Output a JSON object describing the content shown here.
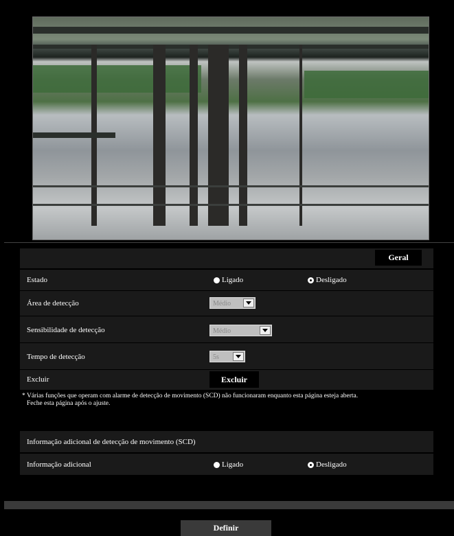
{
  "header_tab": "Geral",
  "rows": {
    "estado": {
      "label": "Estado",
      "on": "Ligado",
      "off": "Desligado",
      "selected": "off"
    },
    "area": {
      "label": "Área de detecção",
      "value": "Médio"
    },
    "sens": {
      "label": "Sensibilidade de detecção",
      "value": "Médio"
    },
    "tempo": {
      "label": "Tempo de detecção",
      "value": "5s"
    },
    "excluir": {
      "label": "Excluir",
      "button": "Excluir"
    }
  },
  "note": {
    "line1": "* Várias funções que operam com alarme de detecção de movimento (SCD) não funcionaram enquanto esta página esteja aberta.",
    "line2": "Feche esta página após o ajuste."
  },
  "scd": {
    "title": "Informação adicional de detecção de movimento (SCD)",
    "label": "Informação adicional",
    "on": "Ligado",
    "off": "Desligado",
    "selected": "off"
  },
  "submit": "Definir"
}
